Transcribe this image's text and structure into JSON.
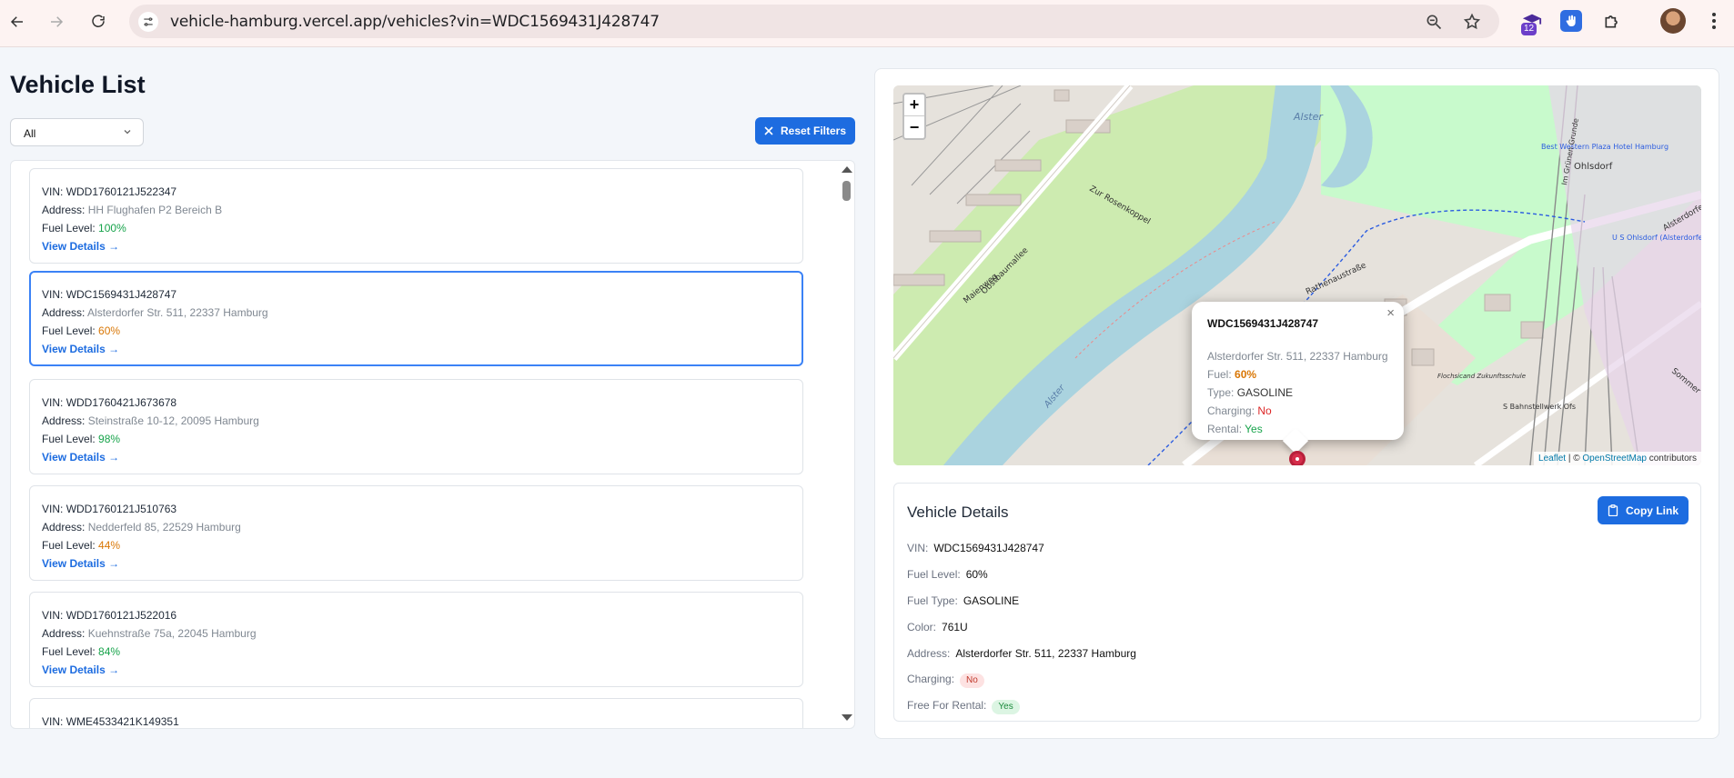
{
  "browser": {
    "url_host": "vehicle-hamburg.vercel.app",
    "url_path": "/vehicles?vin=WDC1569431J428747",
    "extension_badge": "12"
  },
  "page": {
    "title": "Vehicle List",
    "filter": {
      "selected": "All"
    },
    "reset_label": "Reset Filters"
  },
  "labels": {
    "vin": "VIN:",
    "address": "Address:",
    "fuel_level": "Fuel Level:",
    "view_details": "View Details →"
  },
  "vehicles": [
    {
      "vin": "WDD1760121J522347",
      "address": "HH Flughafen P2 Bereich B",
      "fuel": "100%",
      "fuel_color": "green"
    },
    {
      "vin": "WDC1569431J428747",
      "address": "Alsterdorfer Str. 511, 22337 Hamburg",
      "fuel": "60%",
      "fuel_color": "orange"
    },
    {
      "vin": "WDD1760421J673678",
      "address": "Steinstraße 10-12, 20095 Hamburg",
      "fuel": "98%",
      "fuel_color": "green"
    },
    {
      "vin": "WDD1760121J510763",
      "address": "Nedderfeld 85, 22529 Hamburg",
      "fuel": "44%",
      "fuel_color": "orange"
    },
    {
      "vin": "WDD1760121J522016",
      "address": "Kuehnstraße 75a, 22045 Hamburg",
      "fuel": "84%",
      "fuel_color": "green"
    },
    {
      "vin": "WME4533421K149351",
      "address": "",
      "fuel": "",
      "fuel_color": ""
    }
  ],
  "map": {
    "zoom_in": "+",
    "zoom_out": "−",
    "attribution_leaflet": "Leaflet",
    "attribution_sep": " | © ",
    "attribution_osm": "OpenStreetMap",
    "attribution_tail": " contributors",
    "labels": {
      "alster_top": "Alster",
      "alster_bottom": "Alster",
      "ohlsdorf": "Ohlsdorf",
      "obstbaumallee": "Obstbaumallee",
      "maienweg": "Maienweg",
      "zur_rosenbrook": "Zur Rosenkoppel",
      "rathenaustrasse": "Rathenaustraße",
      "alsterdorfer": "Alsterdorfer",
      "sbahn": "S Bahnstellwerk Ofs",
      "us_ohlsdorf": "U S Ohlsdorf (Alsterdorfer Straße)",
      "best_western": "Best Western Plaza Hotel Hamburg",
      "im_gruenen_grunde": "Im Grünen Grunde",
      "sommer": "Sommer",
      "hochschule": "Flochsicand Zukunftsschule"
    },
    "popup": {
      "vin": "WDC1569431J428747",
      "address": "Alsterdorfer Str. 511, 22337 Hamburg",
      "fuel_label": "Fuel:",
      "fuel": "60%",
      "type_label": "Type:",
      "type": "GASOLINE",
      "charging_label": "Charging:",
      "charging": "No",
      "rental_label": "Rental:",
      "rental": "Yes",
      "close": "×"
    }
  },
  "details": {
    "title": "Vehicle Details",
    "copy_label": "Copy Link",
    "vin_label": "VIN:",
    "vin": "WDC1569431J428747",
    "fuel_level_label": "Fuel Level:",
    "fuel_level": "60%",
    "fuel_type_label": "Fuel Type:",
    "fuel_type": "GASOLINE",
    "color_label": "Color:",
    "color": "761U",
    "address_label": "Address:",
    "address": "Alsterdorfer Str. 511, 22337 Hamburg",
    "charging_label": "Charging:",
    "charging": "No",
    "rental_label": "Free For Rental:",
    "rental": "Yes"
  },
  "colors": {
    "primary": "#1d6ce0",
    "selected_border": "#3b82f6",
    "fuel_green": "#16a34a",
    "fuel_orange": "#d97706",
    "water": "#aad3df",
    "park": "#c8facc"
  }
}
